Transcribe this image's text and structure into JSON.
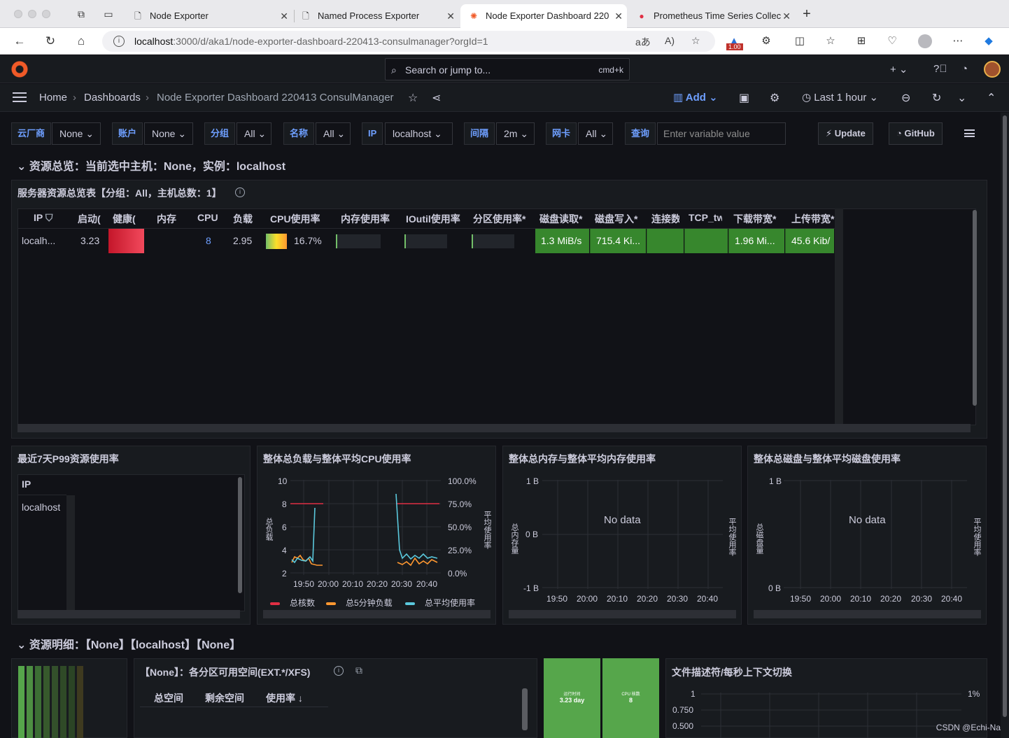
{
  "browser": {
    "tabs": [
      {
        "title": "Node Exporter",
        "favicon": "page-icon"
      },
      {
        "title": "Named Process Exporter",
        "favicon": "page-icon"
      },
      {
        "title": "Node Exporter Dashboard 220",
        "favicon": "grafana-icon"
      },
      {
        "title": "Prometheus Time Series Collec",
        "favicon": "prometheus-icon"
      }
    ],
    "url_host": "localhost",
    "url_path": ":3000/d/aka1/node-exporter-dashboard-220413-consulmanager?orgId=1",
    "ext_badge": "1.00"
  },
  "grafana": {
    "search_placeholder": "Search or jump to...",
    "search_kbd": "cmd+k",
    "breadcrumb": [
      "Home",
      "Dashboards",
      "Node Exporter Dashboard 220413 ConsulManager"
    ],
    "add_label": "Add",
    "time_range": "Last 1 hour"
  },
  "variables": [
    {
      "label": "云厂商",
      "value": "None"
    },
    {
      "label": "账户",
      "value": "None"
    },
    {
      "label": "分组",
      "value": "All"
    },
    {
      "label": "名称",
      "value": "All"
    },
    {
      "label": "IP",
      "value": "localhost"
    },
    {
      "label": "间隔",
      "value": "2m"
    },
    {
      "label": "网卡",
      "value": "All"
    }
  ],
  "query": {
    "label": "查询",
    "placeholder": "Enter variable value"
  },
  "buttons": {
    "update": "Update",
    "github": "GitHub"
  },
  "row1_title": "资源总览：当前选中主机：None，实例：localhost",
  "overview_table": {
    "title": "服务器资源总览表【分组：All，主机总数：1】",
    "columns": [
      "IP",
      "启动(",
      "健康(",
      "内存",
      "CPU",
      "负载",
      "CPU使用率",
      "内存使用率",
      "IOutil使用率",
      "分区使用率*",
      "磁盘读取*",
      "磁盘写入*",
      "连接数",
      "TCP_tw",
      "下载带宽*",
      "上传带宽*"
    ],
    "row": {
      "ip": "localh...",
      "uptime": "3.23",
      "cpu": "8",
      "load": "2.95",
      "cpu_usage": "16.7%",
      "disk_read": "1.3 MiB/s",
      "disk_write": "715.4 Ki...",
      "download": "1.96 Mi...",
      "upload": "45.6 Kib/"
    }
  },
  "p99_panel": {
    "title": "最近7天P99资源使用率",
    "column": "IP",
    "row": "localhost"
  },
  "load_panel": {
    "title": "整体总负载与整体平均CPU使用率",
    "y_left_label": "总负载",
    "y_right_label": "平均使用率",
    "y_left_ticks": [
      "10",
      "8",
      "6",
      "4",
      "2"
    ],
    "y_right_ticks": [
      "100.0%",
      "75.0%",
      "50.0%",
      "25.0%",
      "0.0%"
    ],
    "x_ticks": [
      "19:50",
      "20:00",
      "20:10",
      "20:20",
      "20:30",
      "20:40"
    ],
    "legend": [
      "总核数",
      "总5分钟负载",
      "总平均使用率"
    ]
  },
  "mem_panel": {
    "title": "整体总内存与整体平均内存使用率",
    "y_left_label": "总内存量",
    "y_right_label": "平均使用率",
    "y_ticks": [
      "1 B",
      "0 B",
      "-1 B"
    ],
    "x_ticks": [
      "19:50",
      "20:00",
      "20:10",
      "20:20",
      "20:30",
      "20:40"
    ],
    "nodata": "No data"
  },
  "disk_panel": {
    "title": "整体总磁盘与整体平均磁盘使用率",
    "y_left_label": "总磁盘量",
    "y_right_label": "平均使用率",
    "y_ticks": [
      "1 B",
      "0 B"
    ],
    "x_ticks": [
      "19:50",
      "20:00",
      "20:10",
      "20:20",
      "20:30",
      "20:40"
    ],
    "nodata": "No data"
  },
  "row2_title": "资源明细：【None】【localhost】【None】",
  "partition_panel": {
    "title": "【None】：各分区可用空间(EXT.*/XFS)",
    "columns": [
      "总空间",
      "剩余空间",
      "使用率"
    ]
  },
  "stat_tiles": [
    {
      "label": "运行时间",
      "value": "3.23 day"
    },
    {
      "label": "CPU 核数",
      "value": "8"
    }
  ],
  "fd_panel": {
    "title": "文件描述符/每秒上下文切换",
    "y_ticks": [
      "1",
      "0.750",
      "0.500"
    ],
    "y_right": "1%"
  },
  "watermark": "CSDN @Echi-Na",
  "colors": {
    "accent": "#6e9fff",
    "green": "#37872d",
    "red": "#e02f44",
    "orange": "#ff9830",
    "cyan": "#5ac8dc"
  }
}
